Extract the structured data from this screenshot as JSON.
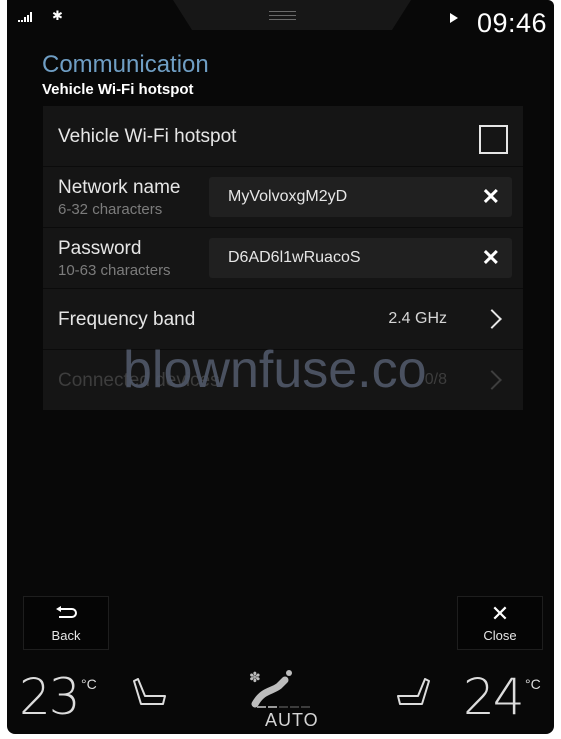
{
  "status_bar": {
    "signal_icon": "signal-bars-icon",
    "bluetooth_icon": "bluetooth-icon",
    "media_icon": "play-icon",
    "time": "09:46"
  },
  "header": {
    "title": "Communication",
    "subtitle": "Vehicle Wi-Fi hotspot",
    "title_color": "#6f9ec4"
  },
  "settings": {
    "hotspot": {
      "label": "Vehicle Wi-Fi hotspot",
      "checked": false
    },
    "network_name": {
      "label": "Network name",
      "hint": "6-32 characters",
      "value": "MyVolvoxgM2yD",
      "clear_icon": "✕"
    },
    "password": {
      "label": "Password",
      "hint": "10-63 characters",
      "value": "D6AD6l1wRuacoS",
      "clear_icon": "✕"
    },
    "frequency_band": {
      "label": "Frequency band",
      "value": "2.4 GHz"
    },
    "connected_devices": {
      "label": "Connected devices",
      "value": "0/8",
      "disabled": true
    }
  },
  "watermark": "blownfuse.co",
  "buttons": {
    "back": {
      "label": "Back",
      "icon": "⮌"
    },
    "close": {
      "label": "Close",
      "icon": "✕"
    }
  },
  "climate": {
    "driver_temp": "23",
    "passenger_temp": "24",
    "unit": "°C",
    "mode": "AUTO",
    "fan_level": 2,
    "fan_levels_total": 5
  }
}
